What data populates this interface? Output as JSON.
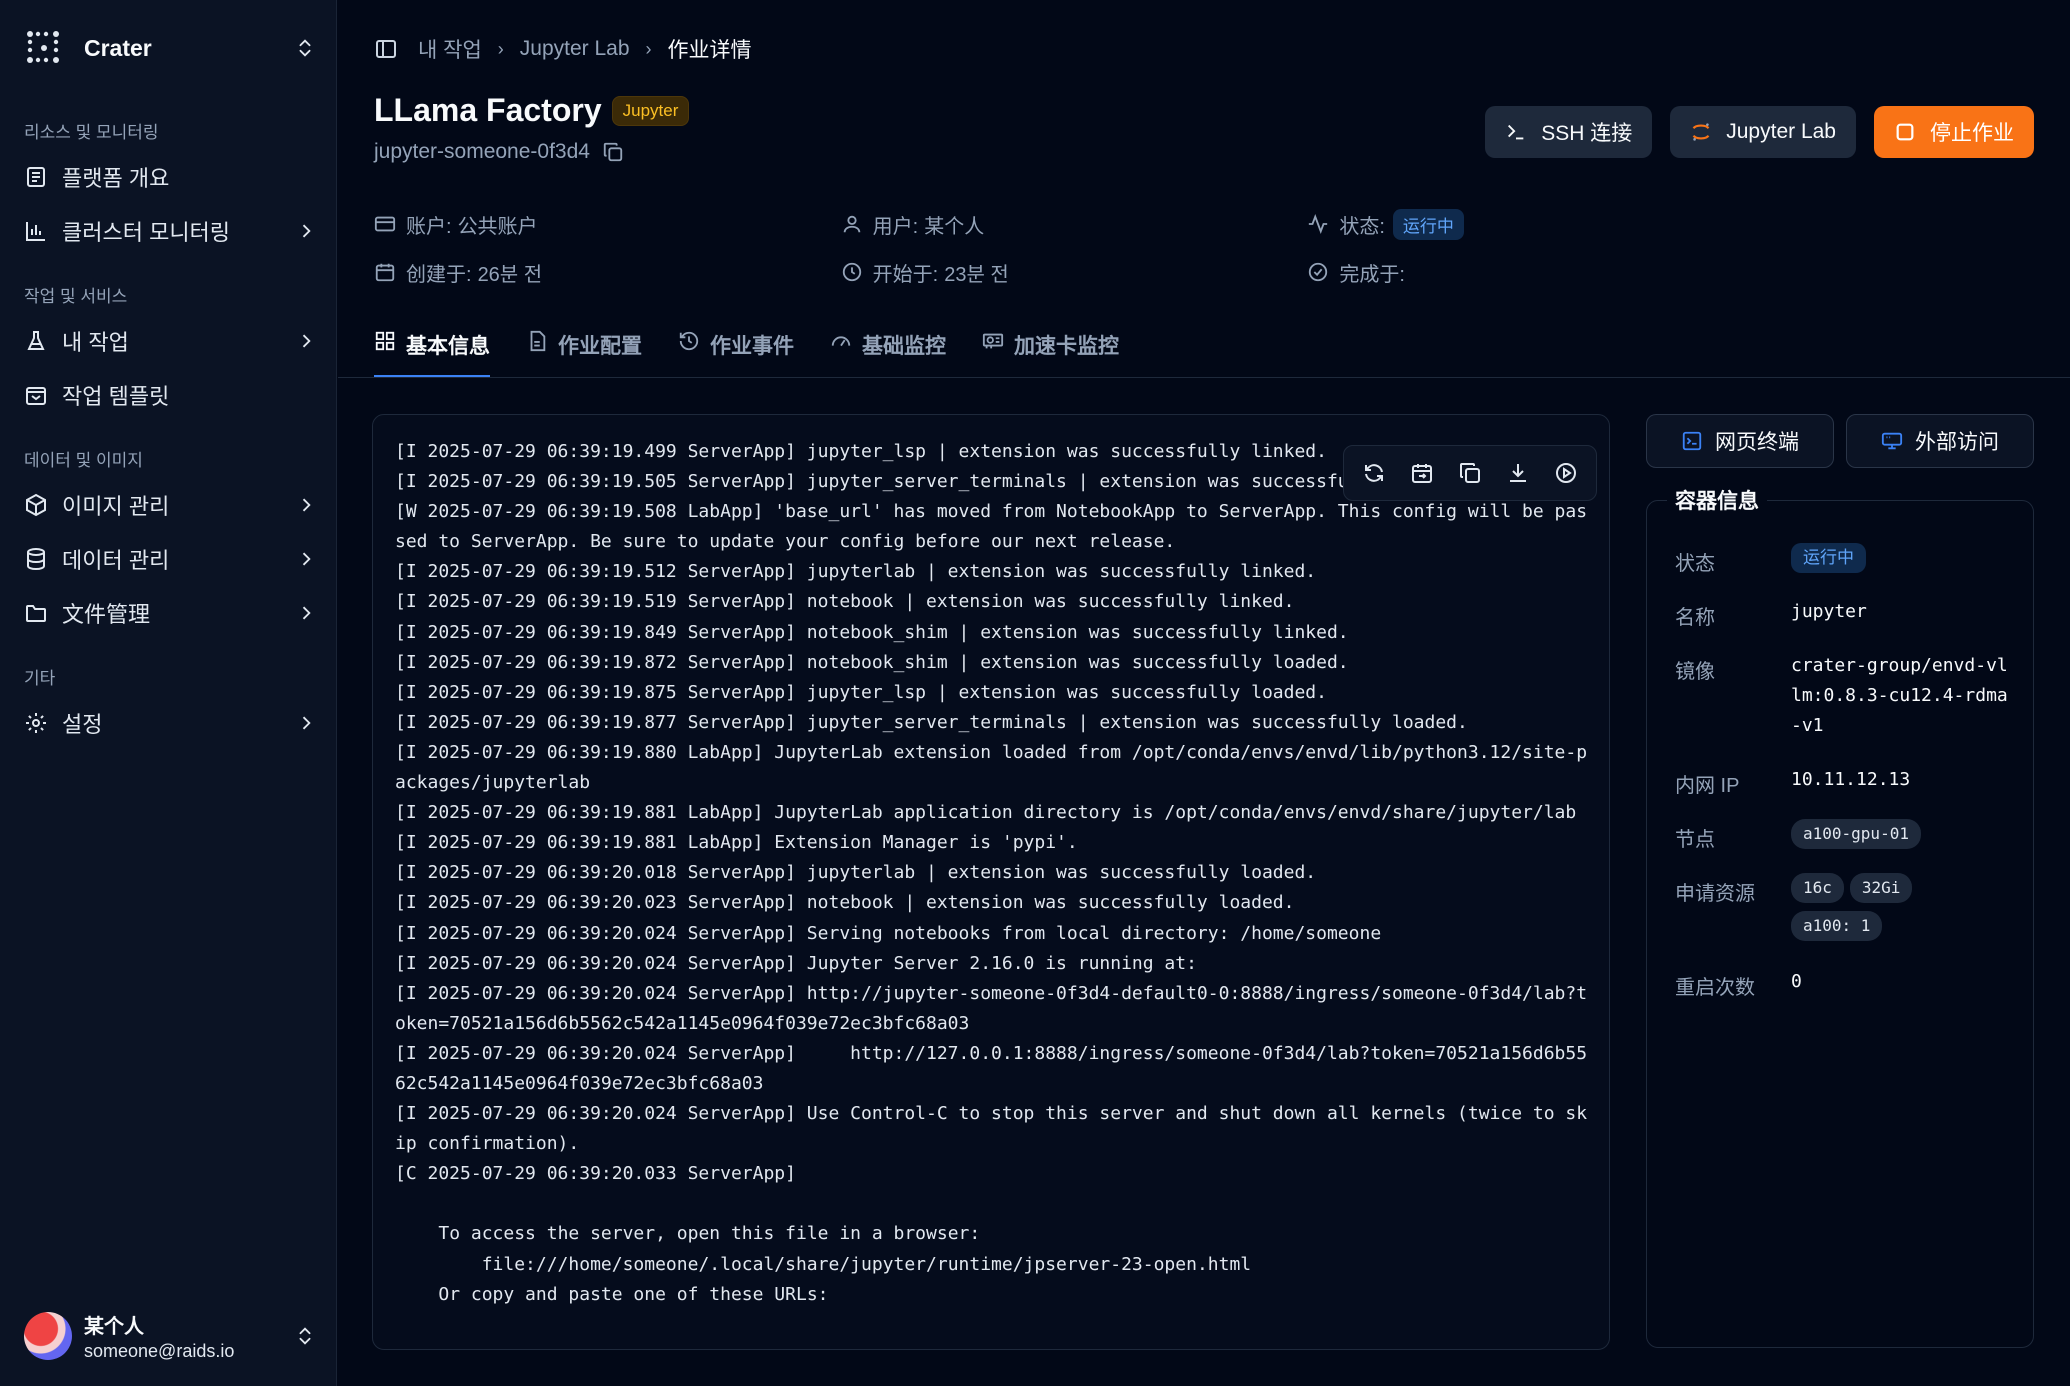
{
  "sidebar": {
    "brand": "Crater",
    "groups": [
      {
        "title": "리소스 및 모니터링",
        "items": [
          {
            "label": "플랫폼 개요",
            "icon": "document-icon",
            "chevron": false
          },
          {
            "label": "클러스터 모니터링",
            "icon": "bar-chart-icon",
            "chevron": true
          }
        ]
      },
      {
        "title": "작업 및 서비스",
        "items": [
          {
            "label": "내 작업",
            "icon": "flask-icon",
            "chevron": true
          },
          {
            "label": "작업 템플릿",
            "icon": "template-icon",
            "chevron": false
          }
        ]
      },
      {
        "title": "데이터 및 이미지",
        "items": [
          {
            "label": "이미지 관리",
            "icon": "package-icon",
            "chevron": true
          },
          {
            "label": "데이터 관리",
            "icon": "database-icon",
            "chevron": true
          },
          {
            "label": "文件管理",
            "icon": "folder-icon",
            "chevron": true
          }
        ]
      },
      {
        "title": "기타",
        "items": [
          {
            "label": "설정",
            "icon": "gear-icon",
            "chevron": true
          }
        ]
      }
    ],
    "user": {
      "name": "某个人",
      "email": "someone@raids.io"
    }
  },
  "breadcrumb": [
    "내 작업",
    "Jupyter Lab",
    "作业详情"
  ],
  "job": {
    "title": "LLama Factory",
    "type_badge": "Jupyter",
    "id": "jupyter-someone-0f3d4"
  },
  "actions": {
    "ssh": "SSH 连接",
    "jupyter": "Jupyter Lab",
    "stop": "停止作业"
  },
  "meta": {
    "account_label": "账户:",
    "account_value": "公共账户",
    "user_label": "用户:",
    "user_value": "某个人",
    "status_label": "状态:",
    "status_value": "运行中",
    "created_label": "创建于:",
    "created_value": "26분 전",
    "started_label": "开始于:",
    "started_value": "23분 전",
    "finished_label": "完成于:",
    "finished_value": ""
  },
  "tabs": [
    "基本信息",
    "作业配置",
    "作业事件",
    "基础监控",
    "加速卡监控"
  ],
  "log_text": "[I 2025-07-29 06:39:19.499 ServerApp] jupyter_lsp | extension was successfully linked.\n[I 2025-07-29 06:39:19.505 ServerApp] jupyter_server_terminals | extension was successfully linked.\n[W 2025-07-29 06:39:19.508 LabApp] 'base_url' has moved from NotebookApp to ServerApp. This config will be passed to ServerApp. Be sure to update your config before our next release.\n[I 2025-07-29 06:39:19.512 ServerApp] jupyterlab | extension was successfully linked.\n[I 2025-07-29 06:39:19.519 ServerApp] notebook | extension was successfully linked.\n[I 2025-07-29 06:39:19.849 ServerApp] notebook_shim | extension was successfully linked.\n[I 2025-07-29 06:39:19.872 ServerApp] notebook_shim | extension was successfully loaded.\n[I 2025-07-29 06:39:19.875 ServerApp] jupyter_lsp | extension was successfully loaded.\n[I 2025-07-29 06:39:19.877 ServerApp] jupyter_server_terminals | extension was successfully loaded.\n[I 2025-07-29 06:39:19.880 LabApp] JupyterLab extension loaded from /opt/conda/envs/envd/lib/python3.12/site-packages/jupyterlab\n[I 2025-07-29 06:39:19.881 LabApp] JupyterLab application directory is /opt/conda/envs/envd/share/jupyter/lab\n[I 2025-07-29 06:39:19.881 LabApp] Extension Manager is 'pypi'.\n[I 2025-07-29 06:39:20.018 ServerApp] jupyterlab | extension was successfully loaded.\n[I 2025-07-29 06:39:20.023 ServerApp] notebook | extension was successfully loaded.\n[I 2025-07-29 06:39:20.024 ServerApp] Serving notebooks from local directory: /home/someone\n[I 2025-07-29 06:39:20.024 ServerApp] Jupyter Server 2.16.0 is running at:\n[I 2025-07-29 06:39:20.024 ServerApp] http://jupyter-someone-0f3d4-default0-0:8888/ingress/someone-0f3d4/lab?token=70521a156d6b5562c542a1145e0964f039e72ec3bfc68a03\n[I 2025-07-29 06:39:20.024 ServerApp]     http://127.0.0.1:8888/ingress/someone-0f3d4/lab?token=70521a156d6b5562c542a1145e0964f039e72ec3bfc68a03\n[I 2025-07-29 06:39:20.024 ServerApp] Use Control-C to stop this server and shut down all kernels (twice to skip confirmation).\n[C 2025-07-29 06:39:20.033 ServerApp]\n\n    To access the server, open this file in a browser:\n        file:///home/someone/.local/share/jupyter/runtime/jpserver-23-open.html\n    Or copy and paste one of these URLs:",
  "side": {
    "terminal_btn": "网页终端",
    "external_btn": "外部访问",
    "container_title": "容器信息",
    "status_label": "状态",
    "status_value": "运行中",
    "name_label": "名称",
    "name_value": "jupyter",
    "image_label": "镜像",
    "image_value": "crater-group/envd-vllm:0.8.3-cu12.4-rdma-v1",
    "ip_label": "内网 IP",
    "ip_value": "10.11.12.13",
    "node_label": "节点",
    "node_value": "a100-gpu-01",
    "res_label": "申请资源",
    "res_cpu": "16c",
    "res_mem": "32Gi",
    "res_gpu": "a100: 1",
    "restart_label": "重启次数",
    "restart_value": "0"
  },
  "colors": {
    "accent": "#3b82f6",
    "stop": "#f97316",
    "status_blue": "#60a5fa",
    "badge_amber": "#fbbf24"
  }
}
